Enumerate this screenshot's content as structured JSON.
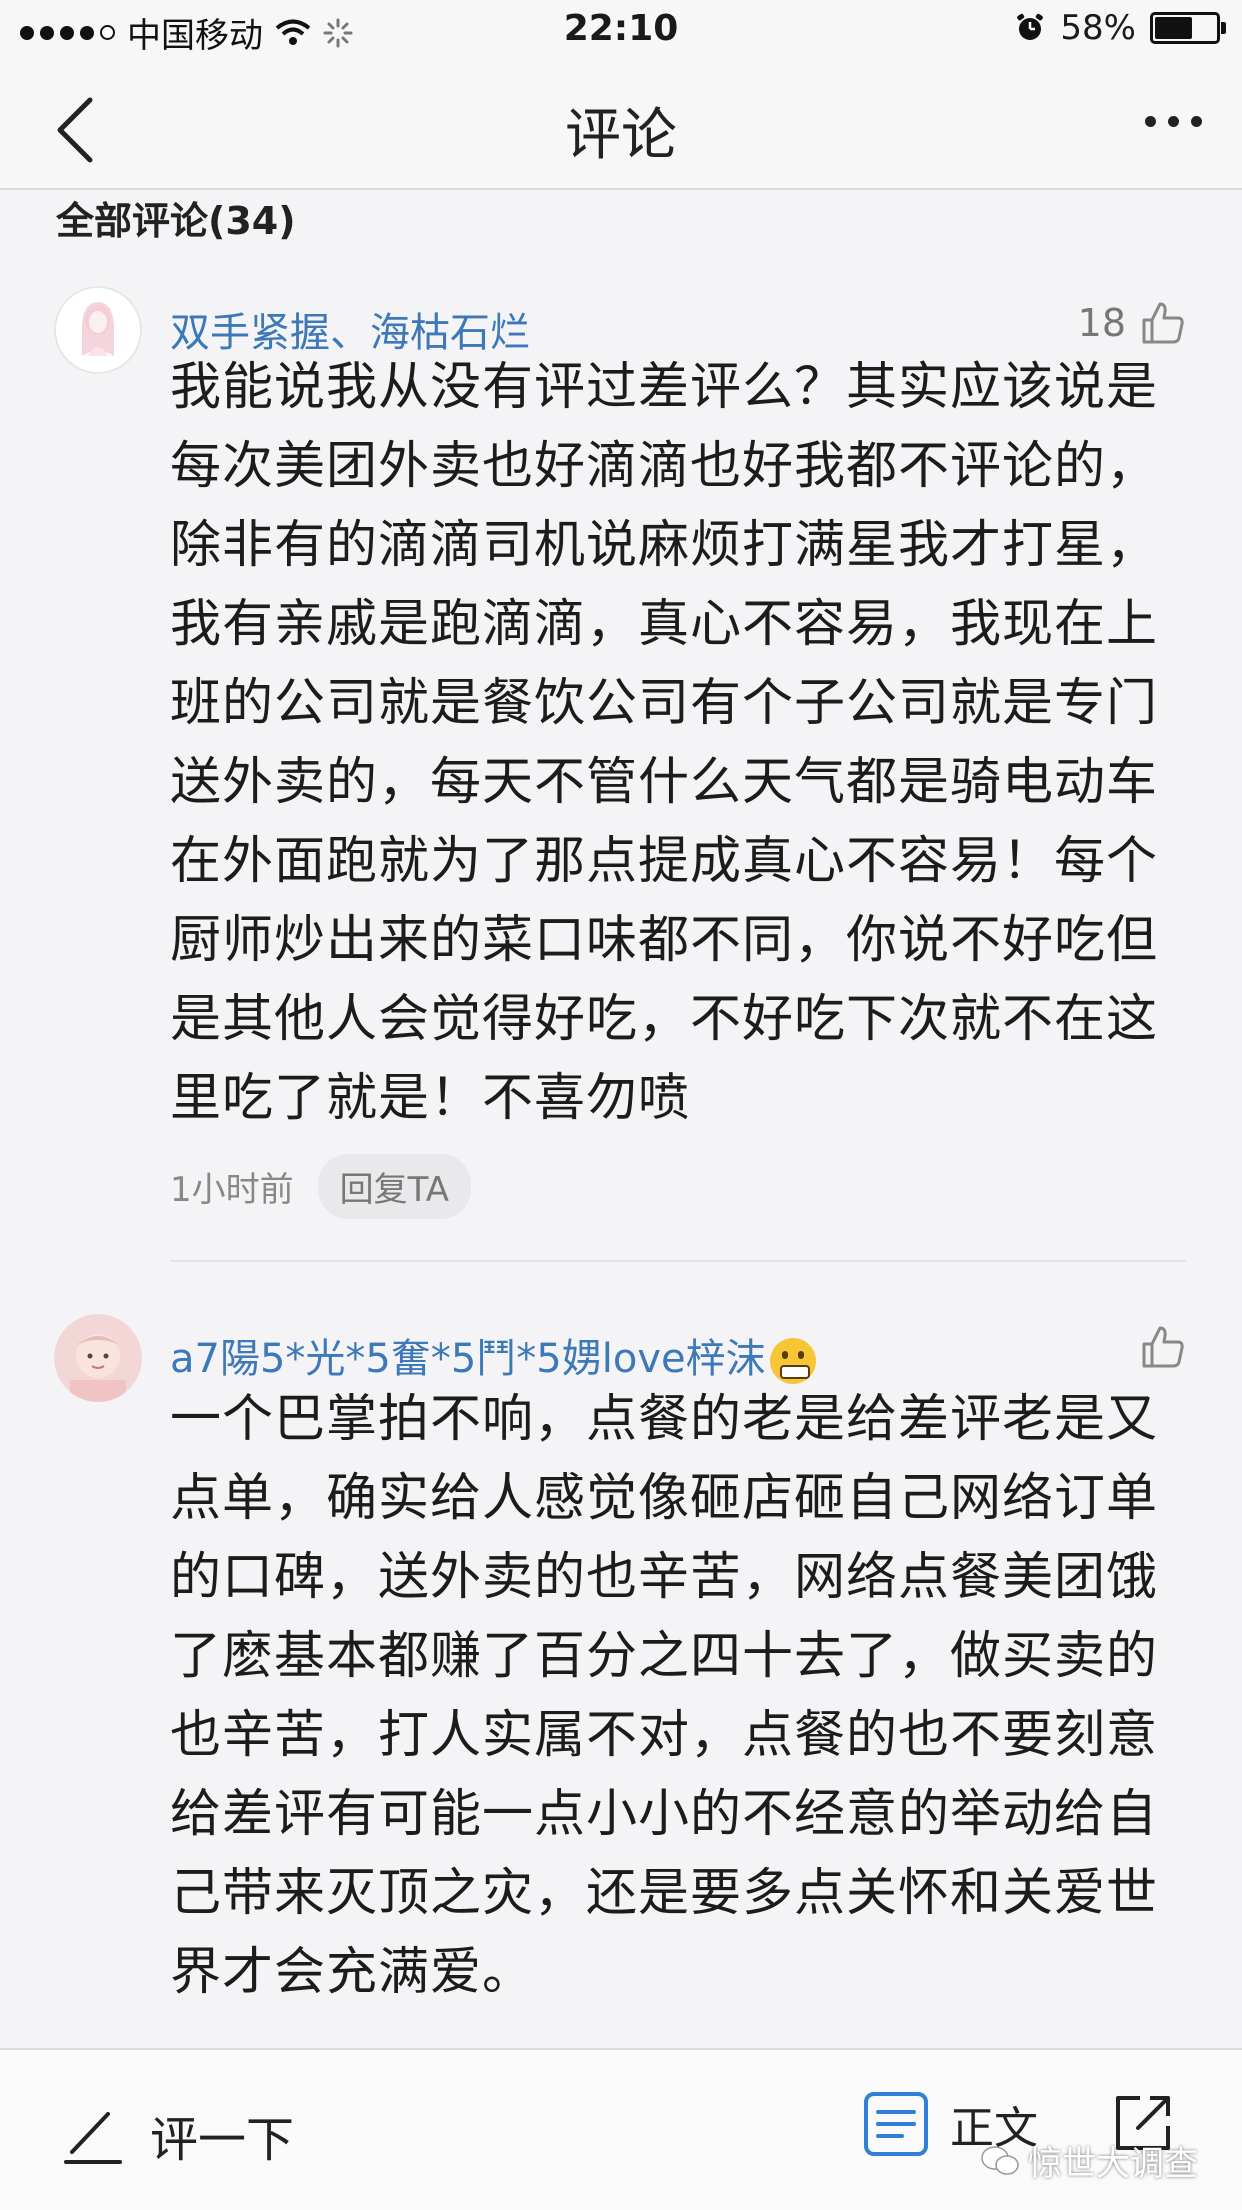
{
  "status_bar": {
    "carrier": "中国移动",
    "time": "22:10",
    "battery": "58%"
  },
  "nav": {
    "title": "评论"
  },
  "section": {
    "title": "全部评论(34)"
  },
  "comments": [
    {
      "username": "双手紧握、海枯石烂",
      "likes": "18",
      "lines": [
        "我能说我从没有评过差评么？其实应该说是",
        "每次美团外卖也好滴滴也好我都不评论的，",
        "除非有的滴滴司机说麻烦打满星我才打星，",
        "我有亲戚是跑滴滴，真心不容易，我现在上",
        "班的公司就是餐饮公司有个子公司就是专门",
        "送外卖的，每天不管什么天气都是骑电动车",
        "在外面跑就为了那点提成真心不容易！每个",
        "厨师炒出来的菜口味都不同，你说不好吃但",
        "是其他人会觉得好吃，不好吃下次就不在这",
        "里吃了就是！不喜勿喷"
      ],
      "time": "1小时前",
      "reply_label": "回复TA"
    },
    {
      "username": "a7陽5*光*5奮*5鬥*5娚love梓沫",
      "lines": [
        "一个巴掌拍不响，点餐的老是给差评老是又",
        "点单，确实给人感觉像砸店砸自己网络订单",
        "的口碑，送外卖的也辛苦，网络点餐美团饿",
        "了麽基本都赚了百分之四十去了，做买卖的",
        "也辛苦，打人实属不对，点餐的也不要刻意",
        "给差评有可能一点小小的不经意的举动给自",
        "己带来灭顶之灾，还是要多点关怀和关爱世",
        "界才会充满爱。"
      ]
    }
  ],
  "bottom_bar": {
    "comment_label": "评一下",
    "article_label": "正文",
    "watermark": "惊世大调查"
  },
  "colors": {
    "username_blue": "#3d78b8",
    "article_icon_blue": "#2f7fd8",
    "content_bg": "#f4f4f6"
  },
  "icons": [
    "back-arrow-icon",
    "more-icon",
    "thumbs-up-icon",
    "pen-icon",
    "document-icon",
    "share-icon",
    "wechat-icon"
  ]
}
